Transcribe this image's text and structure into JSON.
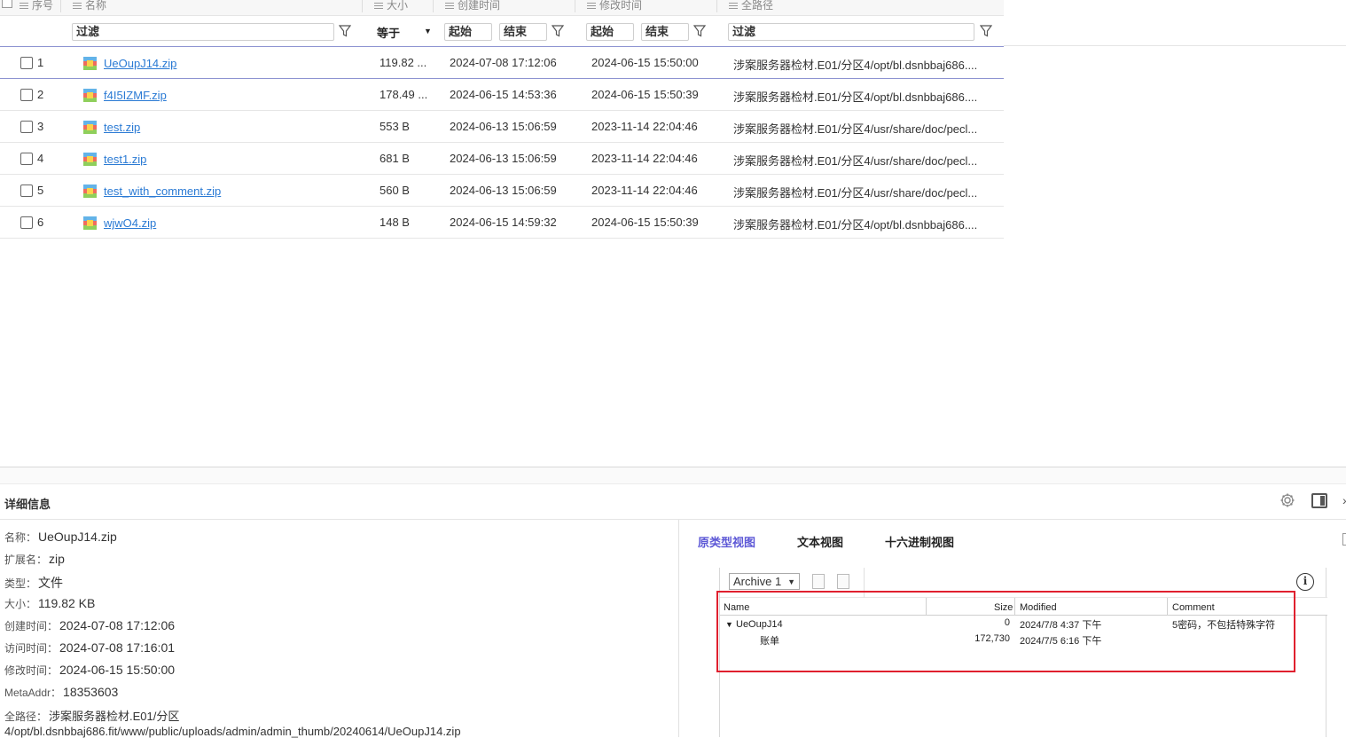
{
  "columns": {
    "index": "序号",
    "name": "名称",
    "size": "大小",
    "created": "创建时间",
    "modified": "修改时间",
    "path": "全路径"
  },
  "filters": {
    "name_placeholder": "过滤",
    "size_operator": "等于",
    "created_start": "起始",
    "created_end": "结束",
    "modified_start": "起始",
    "modified_end": "结束",
    "path_placeholder": "过滤"
  },
  "rows": [
    {
      "index": "1",
      "name": "UeOupJ14.zip",
      "size": "119.82 ...",
      "created": "2024-07-08 17:12:06",
      "modified": "2024-06-15 15:50:00",
      "path": "涉案服务器检材.E01/分区4/opt/bl.dsnbbaj686...."
    },
    {
      "index": "2",
      "name": "f4I5IZMF.zip",
      "size": "178.49 ...",
      "created": "2024-06-15 14:53:36",
      "modified": "2024-06-15 15:50:39",
      "path": "涉案服务器检材.E01/分区4/opt/bl.dsnbbaj686...."
    },
    {
      "index": "3",
      "name": "test.zip",
      "size": "553 B",
      "created": "2024-06-13 15:06:59",
      "modified": "2023-11-14 22:04:46",
      "path": "涉案服务器检材.E01/分区4/usr/share/doc/pecl..."
    },
    {
      "index": "4",
      "name": "test1.zip",
      "size": "681 B",
      "created": "2024-06-13 15:06:59",
      "modified": "2023-11-14 22:04:46",
      "path": "涉案服务器检材.E01/分区4/usr/share/doc/pecl..."
    },
    {
      "index": "5",
      "name": "test_with_comment.zip",
      "size": "560 B",
      "created": "2024-06-13 15:06:59",
      "modified": "2023-11-14 22:04:46",
      "path": "涉案服务器检材.E01/分区4/usr/share/doc/pecl..."
    },
    {
      "index": "6",
      "name": "wjwO4.zip",
      "size": "148 B",
      "created": "2024-06-15 14:59:32",
      "modified": "2024-06-15 15:50:39",
      "path": "涉案服务器检材.E01/分区4/opt/bl.dsnbbaj686...."
    }
  ],
  "detail": {
    "title": "详细信息",
    "props": [
      {
        "key": "名称：",
        "value": "UeOupJ14.zip"
      },
      {
        "key": "扩展名：",
        "value": "zip"
      },
      {
        "key": "类型：",
        "value": "文件"
      },
      {
        "key": "大小：",
        "value": "119.82 KB"
      },
      {
        "key": "创建时间：",
        "value": "2024-07-08 17:12:06"
      },
      {
        "key": "访问时间：",
        "value": "2024-07-08 17:16:01"
      },
      {
        "key": "修改时间：",
        "value": "2024-06-15 15:50:00"
      },
      {
        "key": "MetaAddr：",
        "value": "18353603"
      },
      {
        "key": "全路径：",
        "value": "涉案服务器检材.E01/分区"
      }
    ],
    "path_continued": "4/opt/bl.dsnbbaj686.fit/www/public/uploads/admin/admin_thumb/20240614/UeOupJ14.zip"
  },
  "viewer": {
    "tabs": [
      "原类型视图",
      "文本视图",
      "十六进制视图"
    ],
    "active_tab": 0,
    "archive_select": "Archive 1",
    "grid_headers": {
      "name": "Name",
      "size": "Size",
      "modified": "Modified",
      "comment": "Comment"
    },
    "entries": [
      {
        "name": "UeOupJ14",
        "size": "0",
        "modified": "2024/7/8 4:37 下午",
        "comment": "5密码，不包括特殊字符",
        "expanded": true
      },
      {
        "name": "账单",
        "size": "172,730",
        "modified": "2024/7/5 6:16 下午",
        "comment": ""
      }
    ]
  },
  "colors": {
    "accent": "#5d58d6",
    "link": "#2a7ad4",
    "highlight_box": "#e0202e"
  }
}
